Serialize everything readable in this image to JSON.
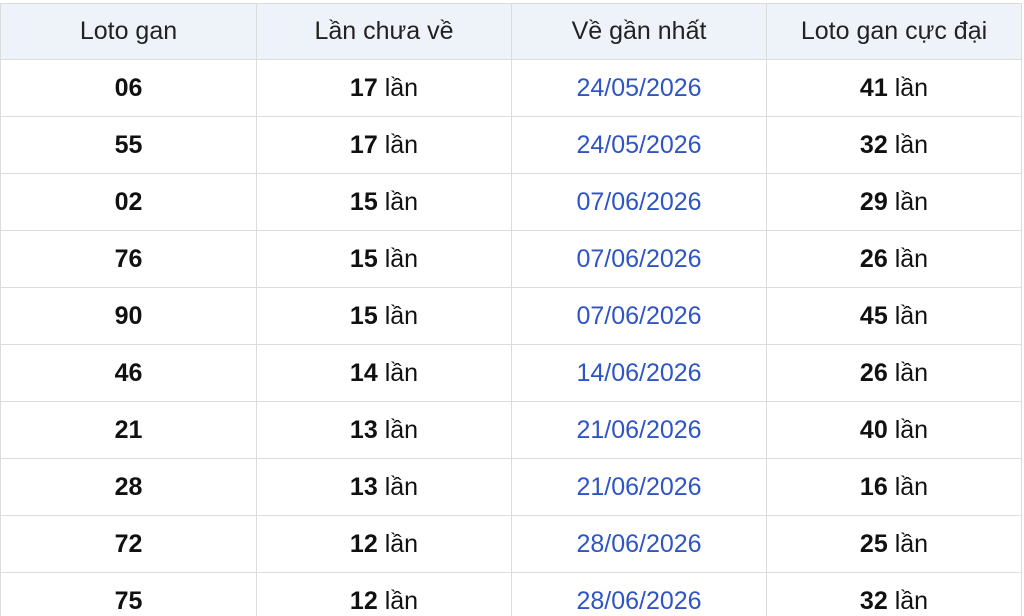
{
  "table": {
    "headers": [
      "Loto gan",
      "Lần chưa về",
      "Về gần nhất",
      "Loto gan cực đại"
    ],
    "unit": "lần",
    "rows": [
      {
        "loto": "06",
        "absent": "17",
        "last": "24/05/2026",
        "max": "41"
      },
      {
        "loto": "55",
        "absent": "17",
        "last": "24/05/2026",
        "max": "32"
      },
      {
        "loto": "02",
        "absent": "15",
        "last": "07/06/2026",
        "max": "29"
      },
      {
        "loto": "76",
        "absent": "15",
        "last": "07/06/2026",
        "max": "26"
      },
      {
        "loto": "90",
        "absent": "15",
        "last": "07/06/2026",
        "max": "45"
      },
      {
        "loto": "46",
        "absent": "14",
        "last": "14/06/2026",
        "max": "26"
      },
      {
        "loto": "21",
        "absent": "13",
        "last": "21/06/2026",
        "max": "40"
      },
      {
        "loto": "28",
        "absent": "13",
        "last": "21/06/2026",
        "max": "16"
      },
      {
        "loto": "72",
        "absent": "12",
        "last": "28/06/2026",
        "max": "25"
      },
      {
        "loto": "75",
        "absent": "12",
        "last": "28/06/2026",
        "max": "32"
      }
    ]
  },
  "colors": {
    "header_bg": "#eef3f9",
    "date_text": "#2f55c4",
    "border": "#dcdcdc"
  }
}
